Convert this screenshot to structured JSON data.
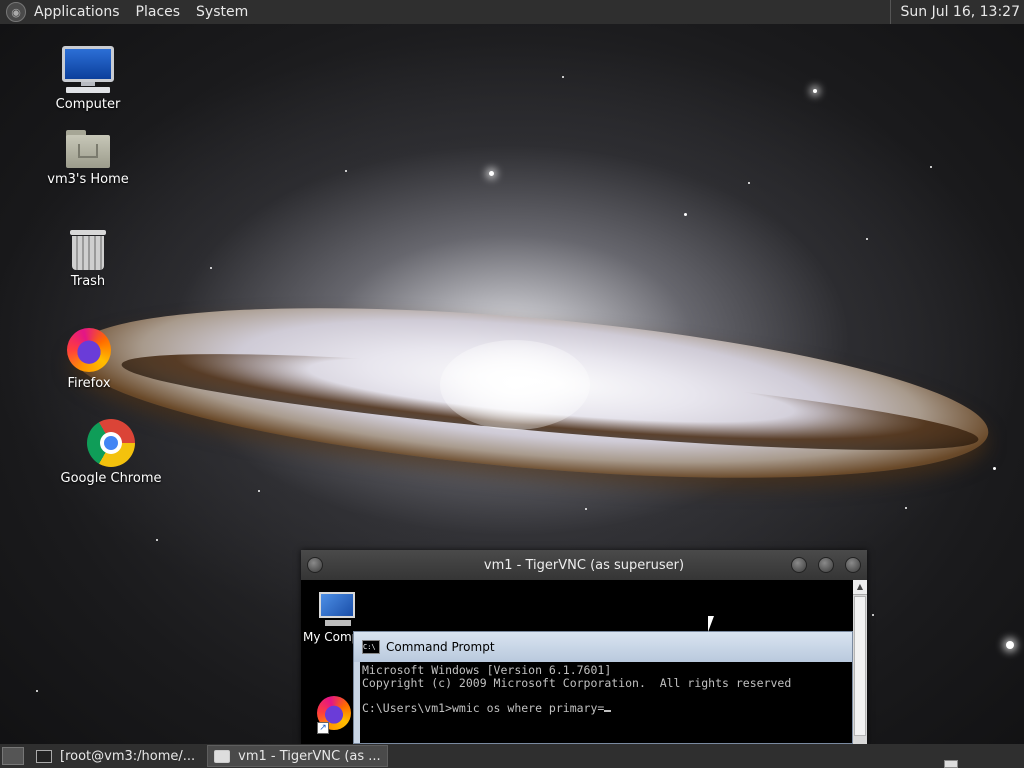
{
  "top_panel": {
    "menus": [
      "Applications",
      "Places",
      "System"
    ],
    "clock": "Sun Jul 16, 13:27"
  },
  "desktop_icons": [
    {
      "label": "Computer",
      "icon": "computer-icon"
    },
    {
      "label": "vm3's Home",
      "icon": "home-folder-icon"
    },
    {
      "label": "Trash",
      "icon": "trash-icon"
    },
    {
      "label": "Firefox",
      "icon": "firefox-icon"
    },
    {
      "label": "Google Chrome",
      "icon": "chrome-icon"
    }
  ],
  "vnc_window": {
    "title": "vm1 - TigerVNC (as superuser)",
    "remote_desktop": {
      "icons": [
        {
          "label": "My Comp",
          "icon": "my-computer-icon"
        },
        {
          "label": "",
          "icon": "firefox-icon"
        }
      ]
    },
    "cmd_window": {
      "title": "Command Prompt",
      "lines": [
        "Microsoft Windows [Version 6.1.7601]",
        "Copyright (c) 2009 Microsoft Corporation.  All rights reserved",
        "",
        "C:\\Users\\vm1>wmic os where primary="
      ]
    }
  },
  "taskbar": {
    "tasks": [
      {
        "label": "[root@vm3:/home/...",
        "icon": "terminal-icon",
        "active": false
      },
      {
        "label": "vm1 - TigerVNC (as ...",
        "icon": "vnc-icon",
        "active": true
      }
    ]
  }
}
